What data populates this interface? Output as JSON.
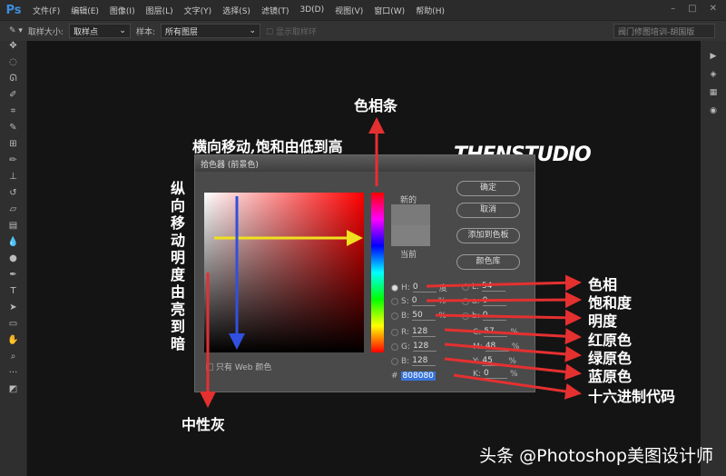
{
  "app": {
    "logo": "Ps",
    "menu": [
      "文件(F)",
      "编辑(E)",
      "图像(I)",
      "图层(L)",
      "文字(Y)",
      "选择(S)",
      "滤镜(T)",
      "3D(D)",
      "视图(V)",
      "窗口(W)",
      "帮助(H)"
    ],
    "window_buttons": [
      "–",
      "□",
      "✕"
    ]
  },
  "options": {
    "sample_size_label": "取样大小:",
    "sample_size": "取样点",
    "sample_label": "样本:",
    "sample": "所有图层",
    "show_ring": "显示取样环",
    "workspace": "阀门修图培训-胡国版"
  },
  "dialog": {
    "title": "拾色器 (前景色)",
    "ok": "确定",
    "cancel": "取消",
    "add_swatch": "添加到色板",
    "libraries": "颜色库",
    "new_label": "新的",
    "current_label": "当前",
    "web_only": "只有 Web 颜色",
    "fields": {
      "H": "0",
      "S": "0",
      "B": "50",
      "R": "128",
      "G": "128",
      "Bb": "128",
      "L": "54",
      "a": "0",
      "b": "0",
      "C": "57",
      "M": "48",
      "Y": "45",
      "K": "0",
      "hex": "808080"
    },
    "units": {
      "deg": "度",
      "pct": "%"
    }
  },
  "annotations": {
    "hue_bar": "色相条",
    "horizontal": "横向移动,饱和由低到高",
    "vertical": "纵向移动明度由亮到暗",
    "neutral_gray": "中性灰",
    "hue": "色相",
    "saturation": "饱和度",
    "brightness": "明度",
    "red": "红原色",
    "green": "绿原色",
    "blue": "蓝原色",
    "hex": "十六进制代码"
  },
  "watermark": "头条 @Photoshop美图设计师",
  "logo_text": "THENSTUDIO"
}
